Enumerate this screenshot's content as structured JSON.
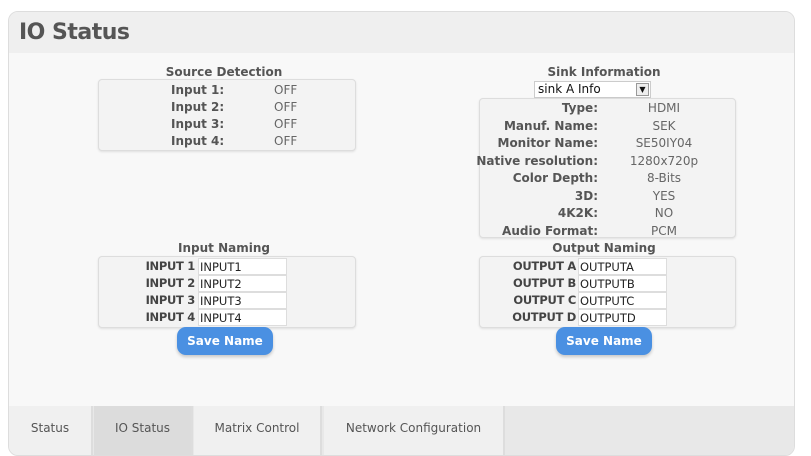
{
  "header": {
    "title": "IO Status"
  },
  "source_detection": {
    "title": "Source Detection",
    "rows": [
      {
        "label": "Input 1:",
        "value": "OFF"
      },
      {
        "label": "Input 2:",
        "value": "OFF"
      },
      {
        "label": "Input 3:",
        "value": "OFF"
      },
      {
        "label": "Input 4:",
        "value": "OFF"
      }
    ]
  },
  "sink_information": {
    "title": "Sink Information",
    "selected": "sink A Info",
    "rows": [
      {
        "label": "Type:",
        "value": "HDMI"
      },
      {
        "label": "Manuf. Name:",
        "value": "SEK"
      },
      {
        "label": "Monitor Name:",
        "value": "SE50IY04"
      },
      {
        "label": "Native resolution:",
        "value": "1280x720p"
      },
      {
        "label": "Color Depth:",
        "value": "8-Bits"
      },
      {
        "label": "3D:",
        "value": "YES"
      },
      {
        "label": "4K2K:",
        "value": "NO"
      },
      {
        "label": "Audio Format:",
        "value": "PCM"
      }
    ]
  },
  "input_naming": {
    "title": "Input Naming",
    "rows": [
      {
        "label": "INPUT 1",
        "value": "INPUT1"
      },
      {
        "label": "INPUT 2",
        "value": "INPUT2"
      },
      {
        "label": "INPUT 3",
        "value": "INPUT3"
      },
      {
        "label": "INPUT 4",
        "value": "INPUT4"
      }
    ],
    "save_label": "Save Name"
  },
  "output_naming": {
    "title": "Output Naming",
    "rows": [
      {
        "label": "OUTPUT A",
        "value": "OUTPUTA"
      },
      {
        "label": "OUTPUT B",
        "value": "OUTPUTB"
      },
      {
        "label": "OUTPUT C",
        "value": "OUTPUTC"
      },
      {
        "label": "OUTPUT D",
        "value": "OUTPUTD"
      }
    ],
    "save_label": "Save Name"
  },
  "tabs": [
    {
      "label": "Status"
    },
    {
      "label": "IO Status",
      "active": true
    },
    {
      "label": "Matrix Control"
    },
    {
      "label": "Network Configuration"
    }
  ]
}
